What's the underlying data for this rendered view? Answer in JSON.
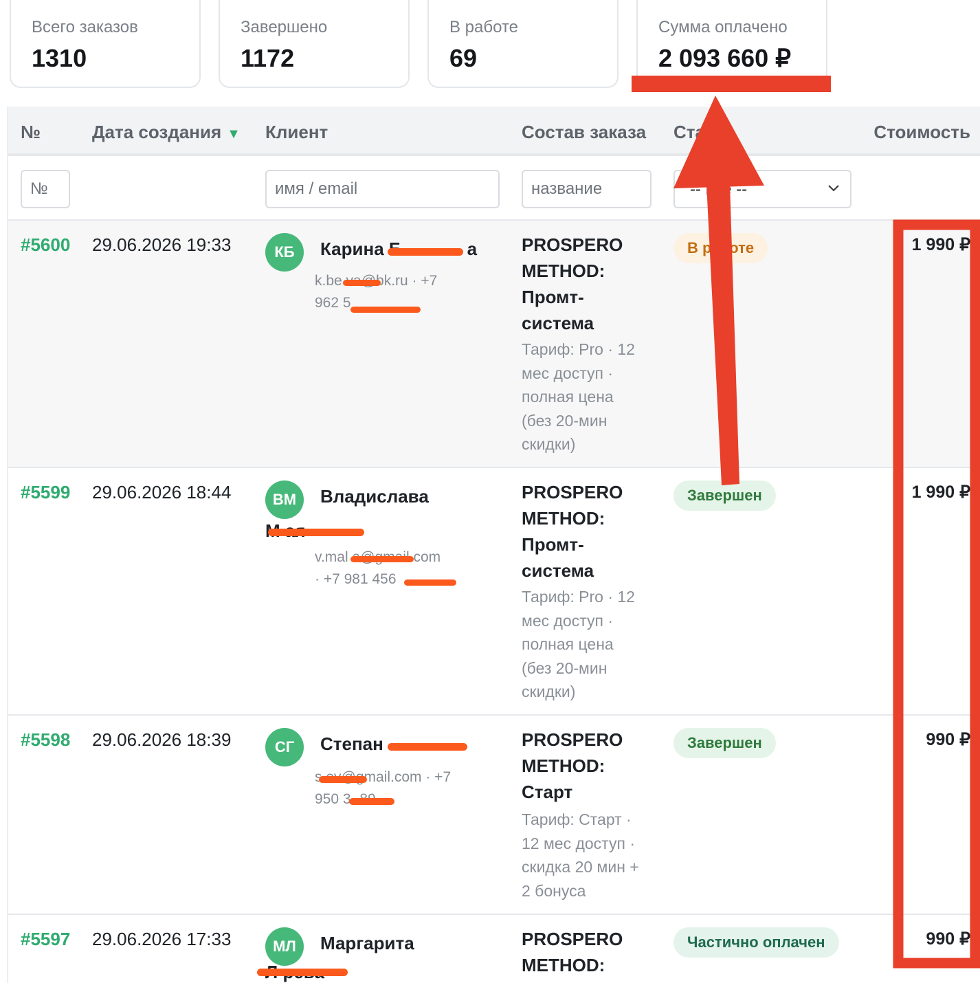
{
  "stats": [
    {
      "label": "Всего заказов",
      "value": "1310"
    },
    {
      "label": "Завершено",
      "value": "1172"
    },
    {
      "label": "В работе",
      "value": "69"
    },
    {
      "label": "Сумма оплачено",
      "value": "2 093 660 ₽"
    }
  ],
  "table": {
    "headers": {
      "number": "№",
      "date": "Дата создания",
      "sort_indicator": "▼",
      "client": "Клиент",
      "items": "Состав заказа",
      "status": "Ста",
      "cost": "Стоимость"
    },
    "filters": {
      "number_placeholder": "№",
      "client_placeholder": "имя / email",
      "items_placeholder": "название",
      "status_value": "-- все --"
    },
    "rows": [
      {
        "number": "#5600",
        "date": "29.06.2026 19:33",
        "initials": "КБ",
        "name": "Карина Б",
        "name_tail": "а",
        "contact_line1": "k.be    va@bk.ru · +7",
        "contact_line2": "962 5",
        "product_line1": "PROSPERO",
        "product_line2": "METHOD:",
        "product_line3": "Промт-",
        "product_line4": "система",
        "desc_line1": "Тариф: Pro · 12",
        "desc_line2": "мес доступ ·",
        "desc_line3": "полная цена",
        "desc_line4": "(без 20-мин",
        "desc_line5": "скидки)",
        "status": "В работе",
        "price": "1 990 ₽"
      },
      {
        "number": "#5599",
        "date": "29.06.2026 18:44",
        "initials": "ВМ",
        "name": "Владислава",
        "name_line2": "М         ая",
        "contact_line1": "v.mal         a@gmail.com",
        "contact_line2": "· +7 981 456",
        "product_line1": "PROSPERO",
        "product_line2": "METHOD:",
        "product_line3": "Промт-",
        "product_line4": "система",
        "desc_line1": "Тариф: Pro · 12",
        "desc_line2": "мес доступ ·",
        "desc_line3": "полная цена",
        "desc_line4": "(без 20-мин",
        "desc_line5": "скидки)",
        "status": "Завершен",
        "price": "1 990 ₽"
      },
      {
        "number": "#5598",
        "date": "29.06.2026 18:39",
        "initials": "СГ",
        "name": "Степан",
        "contact_line1": "s         ev@gmail.com · +7",
        "contact_line2": "950 3        -89",
        "product_line1": "PROSPERO",
        "product_line2": "METHOD:",
        "product_line3": "Старт",
        "desc_line1": "Тариф: Старт ·",
        "desc_line2": "12 мес доступ ·",
        "desc_line3": "скидка 20 мин +",
        "desc_line4": "2 бонуса",
        "status": "Завершен",
        "price": "990 ₽"
      },
      {
        "number": "#5597",
        "date": "29.06.2026 17:33",
        "initials": "МЛ",
        "name": "Маргарита",
        "name_line2": "Л       рева",
        "product_line1": "PROSPERO",
        "product_line2": "METHOD:",
        "status": "Частично оплачен",
        "price": "990 ₽"
      }
    ]
  },
  "colors": {
    "accent_green": "#2fab6f",
    "annotation_red": "#e8402a",
    "redaction_orange": "#fb5a1c"
  }
}
